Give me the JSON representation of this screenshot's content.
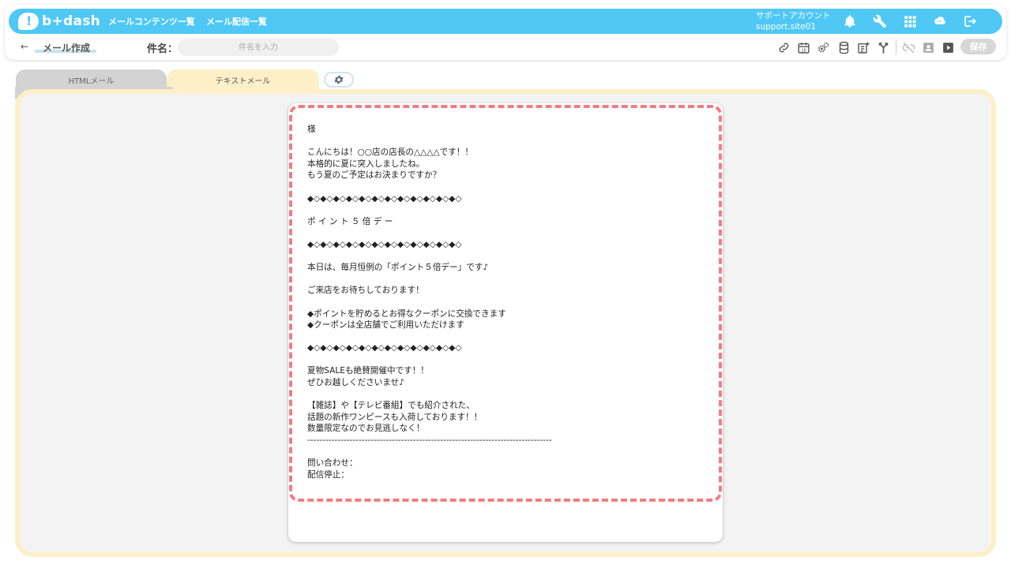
{
  "header": {
    "logo_text": "b+dash",
    "nav": [
      "メールコンテンツ一覧",
      "メール配信一覧"
    ],
    "account_name": "サポートアカウント",
    "account_id": "support.site01",
    "icons": [
      "bell-icon",
      "wrench-icon",
      "apps-grid-icon",
      "cloud-chat-icon",
      "logout-icon"
    ]
  },
  "toolbar": {
    "back_arrow": "←",
    "page_title": "メール作成",
    "subject_label": "件名：",
    "subject_placeholder": "件名を入力",
    "subject_value": "",
    "tools": [
      "link-icon",
      "calendar-icon",
      "settings-gears-icon",
      "database-icon",
      "add-block-icon",
      "branch-icon",
      "link-off-icon",
      "contact-icon",
      "preview-play-icon"
    ],
    "save_label": "保存"
  },
  "tabs": [
    {
      "label": "HTMLメール",
      "active": false
    },
    {
      "label": "テキストメール",
      "active": true
    }
  ],
  "mail": {
    "body": "様\n\nこんにちは！○○店の店長の△△△△です！！\n本格的に夏に突入しましたね。\nもう夏のご予定はお決まりですか？\n\n◆◇◆◇◆◇◆◇◆◇◆◇◆◇◆◇◆◇◆◇◆◇◆◇\n\nポ イ ン ト ５ 倍 デ ー\n\n◆◇◆◇◆◇◆◇◆◇◆◇◆◇◆◇◆◇◆◇◆◇◆◇\n\n本日は、毎月恒例の「ポイント５倍デー」です♪\n\nご来店をお待ちしております！\n\n◆ポイントを貯めるとお得なクーポンに交換できます\n◆クーポンは全店舗でご利用いただけます\n\n◆◇◆◇◆◇◆◇◆◇◆◇◆◇◆◇◆◇◆◇◆◇◆◇\n\n夏物SALEも絶賛開催中です！！\nぜひお越しくださいませ♪\n\n【雑誌】や【テレビ番組】でも紹介された、\n話題の新作ワンピースも入荷しております！！\n数量限定なのでお見逃しなく！\n---------------------------------------------------------------------------------\n\n問い合わせ：\n配信停止："
  },
  "colors": {
    "topbar": "#4fc8f5",
    "tab_active": "#fdf0c8",
    "tab_inactive": "#d3d3d3",
    "dashed_frame": "#f27c82",
    "save_disabled": "#d7d7d7"
  }
}
